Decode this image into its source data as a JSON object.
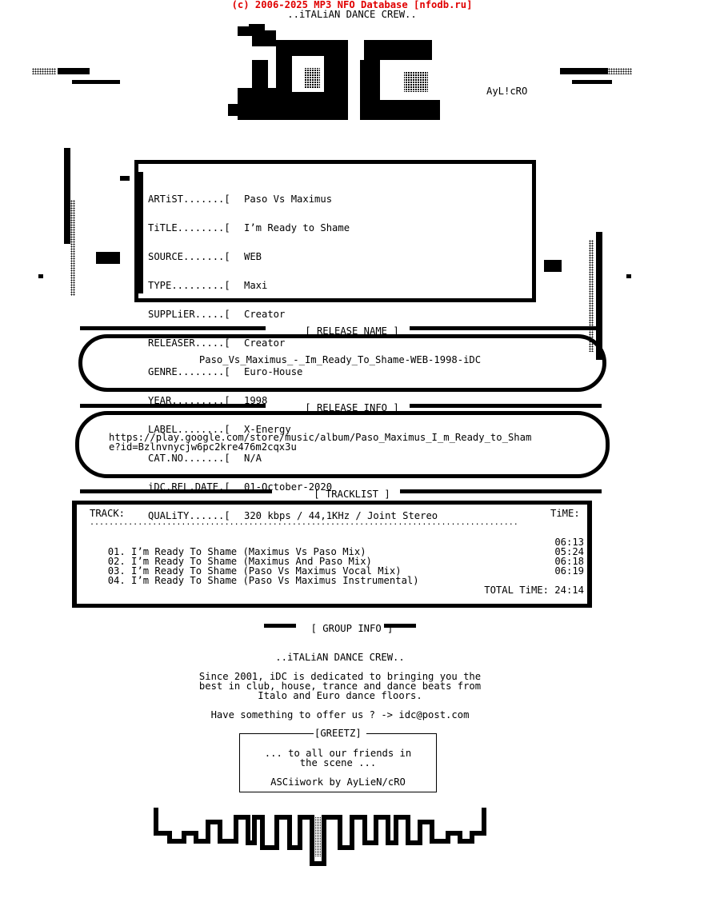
{
  "header": {
    "copyright": "(c) 2006-2025 MP3 NFO Database [nfodb.ru]",
    "group_tagline": "..iTALiAN DANCE CREW.."
  },
  "logo": {
    "text": "iDC",
    "artist_tag": "AyL!cRO"
  },
  "release_details": [
    {
      "key": "ARTiST.......[",
      "value": "Paso Vs Maximus"
    },
    {
      "key": "TiTLE........[",
      "value": "I’m Ready to Shame"
    },
    {
      "key": "SOURCE.......[",
      "value": "WEB"
    },
    {
      "key": "TYPE.........[",
      "value": "Maxi"
    },
    {
      "key": "SUPPLiER.....[",
      "value": "Creator"
    },
    {
      "key": "RELEASER.....[",
      "value": "Creator"
    },
    {
      "key": "GENRE........[",
      "value": "Euro-House"
    },
    {
      "key": "YEAR.........[",
      "value": "1998"
    },
    {
      "key": "LABEL........[",
      "value": "X-Energy"
    },
    {
      "key": "CAT.NO.......[",
      "value": "N/A"
    },
    {
      "key": "iDC.REL.DATE.[",
      "value": "01-October-2020"
    },
    {
      "key": "QUALiTY......[",
      "value": "320 kbps / 44,1KHz / Joint Stereo"
    }
  ],
  "release_name": {
    "title": "[ RELEASE NAME ]",
    "value": "Paso_Vs_Maximus_-_Im_Ready_To_Shame-WEB-1998-iDC"
  },
  "release_info": {
    "title": "[ RELEASE INFO ]",
    "url_line1": "https://play.google.com/store/music/album/Paso_Maximus_I_m_Ready_to_Sham",
    "url_line2": "e?id=Bzlnvnycjw6pc2kre476m2cqx3u"
  },
  "tracklist": {
    "title": "[ TRACKLIST ]",
    "col_track": "TRACK:",
    "col_time": "TiME:",
    "dots": ".........................................................................................",
    "tracks": [
      {
        "num": "01.",
        "name": "I’m Ready To Shame (Maximus Vs Paso Mix)",
        "time": "06:13"
      },
      {
        "num": "02.",
        "name": "I’m Ready To Shame (Maximus And Paso Mix)",
        "time": "05:24"
      },
      {
        "num": "03.",
        "name": "I’m Ready To Shame (Paso Vs Maximus Vocal Mix)",
        "time": "06:18"
      },
      {
        "num": "04.",
        "name": "I’m Ready To Shame (Paso Vs Maximus Instrumental)",
        "time": "06:19"
      }
    ],
    "total_label": "TOTAL TiME: 24:14"
  },
  "group_info": {
    "title": "[ GROUP INFO ]",
    "name": "..iTALiAN DANCE CREW..",
    "desc_line1": "Since 2001, iDC is dedicated to bringing you the",
    "desc_line2": "best in club, house, trance and dance beats from",
    "desc_line3": "Italo and Euro dance floors.",
    "contact": "Have something to offer us ? -> idc@post.com"
  },
  "greetz": {
    "title": "[GREETZ]",
    "line1": "... to all our friends in",
    "line2": "the scene ...",
    "credit": "ASCiiwork by AyLieN/cRO"
  }
}
